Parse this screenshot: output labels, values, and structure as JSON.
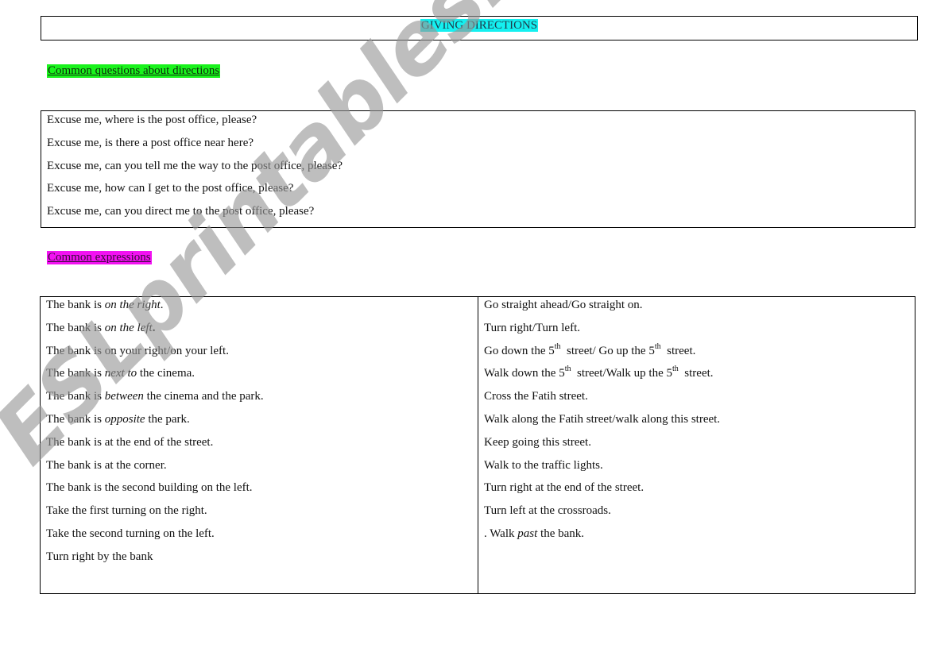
{
  "document": {
    "title": "GIVING DIRECTIONS",
    "colors": {
      "title_highlight": "#14f0f0",
      "questions_highlight": "#19f31c",
      "expressions_highlight": "#f212f2"
    }
  },
  "questions": {
    "heading": "Common questions about directions",
    "items": [
      "Excuse me, where is the post office, please?",
      "Excuse me, is there a post office near here?",
      "Excuse me, can you tell me the way to the post office, please?",
      "Excuse me, how can I get to the post office, please?",
      "Excuse me, can you direct me to the post office, please?"
    ]
  },
  "expressions": {
    "heading": "Common expressions",
    "left": [
      {
        "pre": "The bank is ",
        "em": "on the right",
        "post": "."
      },
      {
        "pre": "The bank is ",
        "em": "on the left",
        "post": "."
      },
      {
        "pre": "The bank is on your right/on your left.",
        "em": "",
        "post": ""
      },
      {
        "pre": "The bank is ",
        "em": "next to",
        "post": " the cinema."
      },
      {
        "pre": "The bank is ",
        "em": "between",
        "post": " the cinema and the park."
      },
      {
        "pre": "The bank is ",
        "em": "opposite",
        "post": " the park."
      },
      {
        "pre": "The bank is at the end of the street.",
        "em": "",
        "post": ""
      },
      {
        "pre": "The bank is at the corner.",
        "em": "",
        "post": ""
      },
      {
        "pre": "The bank is the second building on the left.",
        "em": "",
        "post": ""
      },
      {
        "pre": "Take the first turning on the right.",
        "em": "",
        "post": ""
      },
      {
        "pre": "Take the second turning on the left.",
        "em": "",
        "post": ""
      },
      {
        "pre": "Turn right by the bank",
        "em": "",
        "post": ""
      }
    ],
    "right": [
      {
        "text": "Go straight ahead/Go straight on."
      },
      {
        "text": "Turn right/Turn left."
      },
      {
        "a": "Go down the 5",
        "sup1": "th",
        "b": "  street/ Go up the 5",
        "sup2": "th",
        "c": "  street."
      },
      {
        "a": "Walk down the 5",
        "sup1": "th",
        "b": "  street/Walk up the 5",
        "sup2": "th",
        "c": "  street."
      },
      {
        "text": "Cross the Fatih street."
      },
      {
        "text": "Walk along the Fatih street/walk along this street."
      },
      {
        "text": "Keep going this street."
      },
      {
        "text": "Walk to the traffic lights."
      },
      {
        "text": "Turn right at the end of the street."
      },
      {
        "text": "Turn left at the crossroads."
      },
      {
        "pre": ". Walk ",
        "em": "past",
        "post": " the bank."
      }
    ]
  },
  "watermark": "ESLprintables.com"
}
